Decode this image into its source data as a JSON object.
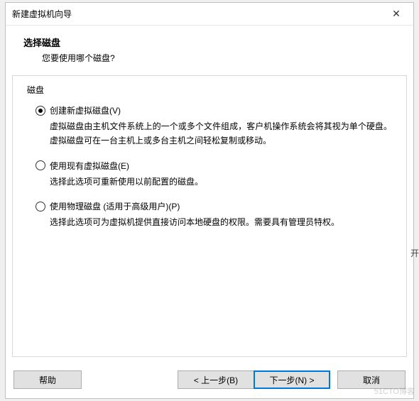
{
  "window": {
    "title": "新建虚拟机向导",
    "close": "✕"
  },
  "header": {
    "title": "选择磁盘",
    "subtitle": "您要使用哪个磁盘?"
  },
  "group": {
    "label": "磁盘"
  },
  "options": [
    {
      "label": "创建新虚拟磁盘(V)",
      "description": "虚拟磁盘由主机文件系统上的一个或多个文件组成，客户机操作系统会将其视为单个硬盘。虚拟磁盘可在一台主机上或多台主机之间轻松复制或移动。",
      "selected": true
    },
    {
      "label": "使用现有虚拟磁盘(E)",
      "description": "选择此选项可重新使用以前配置的磁盘。",
      "selected": false
    },
    {
      "label": "使用物理磁盘 (适用于高级用户)(P)",
      "description": "选择此选项可为虚拟机提供直接访问本地硬盘的权限。需要具有管理员特权。",
      "selected": false
    }
  ],
  "buttons": {
    "help": "帮助",
    "back": "< 上一步(B)",
    "next": "下一步(N) >",
    "cancel": "取消"
  },
  "stray": "开",
  "watermark": "51CTO博客"
}
